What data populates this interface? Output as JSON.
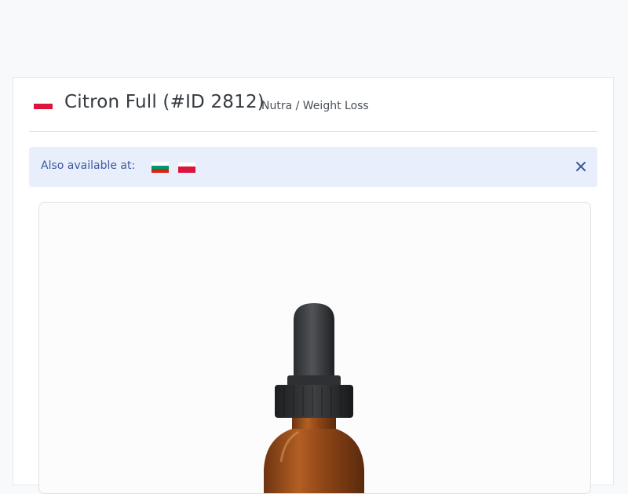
{
  "offer": {
    "title": "Citron Full (#ID 2812)",
    "category": "Nutra / Weight Loss",
    "country_flag": "poland-flag"
  },
  "availability": {
    "label": "Also available at:",
    "flags": [
      "bulgaria-flag",
      "poland-flag"
    ],
    "close_icon": "close-icon"
  },
  "product_image": {
    "icon": "dropper-bottle-image"
  },
  "colors": {
    "alert_bg": "#e8eefc",
    "alert_text": "#3c5a9a",
    "bottle_amber": "#a0521c",
    "cap_dark": "#3a3c3f"
  }
}
